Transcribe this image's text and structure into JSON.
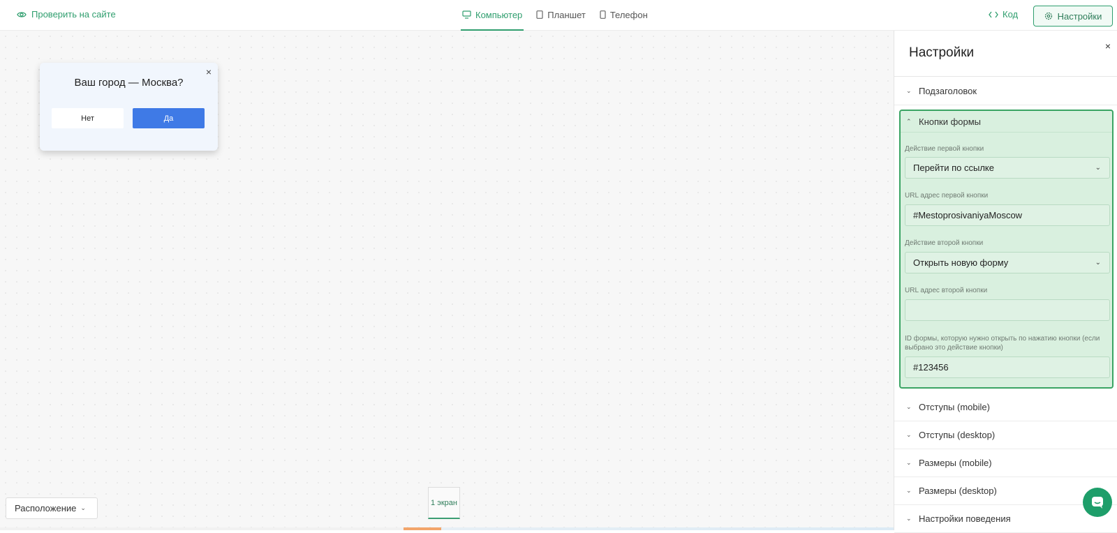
{
  "topbar": {
    "check_site": "Проверить на сайте",
    "devices": [
      "Компьютер",
      "Планшет",
      "Телефон"
    ],
    "code": "Код",
    "settings": "Настройки"
  },
  "popup": {
    "title": "Ваш город — Москва?",
    "no": "Нет",
    "yes": "Да",
    "close": "×"
  },
  "canvas": {
    "layout_label": "Расположение",
    "screen_tab": "1 экран"
  },
  "panel": {
    "title": "Настройки",
    "close": "×",
    "subtitle_section": "Подзаголовок",
    "buttons_section": "Кнопки формы",
    "fields": {
      "first_action_label": "Действие первой кнопки",
      "first_action_value": "Перейти по ссылке",
      "first_url_label": "URL адрес первой кнопки",
      "first_url_value": "#MestoprosivaniyaMoscow",
      "second_action_label": "Действие второй кнопки",
      "second_action_value": "Открыть новую форму",
      "second_url_label": "URL адрес второй кнопки",
      "second_url_value": "",
      "form_id_label": "ID формы, которую нужно открыть по нажатию кнопки (если выбрано это действие кнопки)",
      "form_id_value": "#123456"
    },
    "sections_after": [
      "Отступы (mobile)",
      "Отступы (desktop)",
      "Размеры (mobile)",
      "Размеры (desktop)",
      "Настройки поведения"
    ]
  },
  "colors": {
    "accent": "#2f9e6e",
    "primary_button": "#3f7ae6",
    "active_section_bg": "#d9f0df"
  }
}
